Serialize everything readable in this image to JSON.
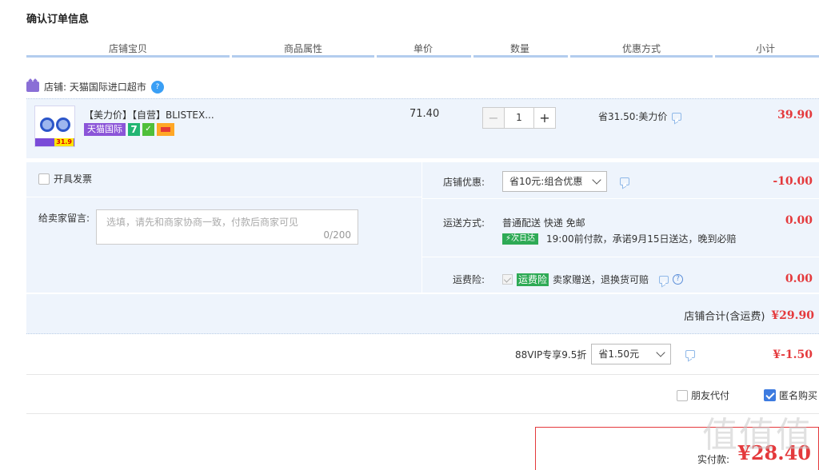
{
  "page_title": "确认订单信息",
  "columns": [
    "店铺宝贝",
    "商品属性",
    "单价",
    "数量",
    "优惠方式",
    "小计"
  ],
  "store": {
    "label": "店铺: 天猫国际进口超市"
  },
  "item": {
    "name": "【美力价】【自营】BLISTEX...",
    "thumb_price": "31.9",
    "badge_tmall": "天猫国际",
    "badge_seven": "7",
    "unit_price": "71.40",
    "quantity": "1",
    "discount_text": "省31.50:美力价",
    "subtotal": "39.90"
  },
  "invoice": {
    "label": "开具发票"
  },
  "memo": {
    "label": "给卖家留言:",
    "placeholder": "选填，请先和商家协商一致，付款后商家可见",
    "count": "0/200"
  },
  "store_discount": {
    "label": "店铺优惠:",
    "selected": "省10元:组合优惠",
    "amount": "-10.00"
  },
  "shipping": {
    "label": "运送方式:",
    "method": "普通配送 快递 免邮",
    "tag": "次日达",
    "note": "19:00前付款，承诺9月15日送达，晚到必赔",
    "amount": "0.00"
  },
  "insurance": {
    "label": "运费险:",
    "tag": "运费险",
    "text": "卖家赠送，退换货可赔",
    "amount": "0.00"
  },
  "store_total": {
    "label": "店铺合计(含运费)",
    "amount": "¥29.90"
  },
  "vip": {
    "label": "88VIP专享9.5折",
    "selected": "省1.50元",
    "amount": "¥-1.50"
  },
  "options": {
    "friend_pay": "朋友代付",
    "anonymous": "匿名购买"
  },
  "payment": {
    "label": "实付款:",
    "amount": "¥28.40"
  },
  "watermark": "值值值",
  "colors": {
    "accent_red": "#e4393c",
    "panel_bg": "#eef4fc",
    "header_line": "#b3cdee",
    "tag_green": "#2eaa55"
  }
}
